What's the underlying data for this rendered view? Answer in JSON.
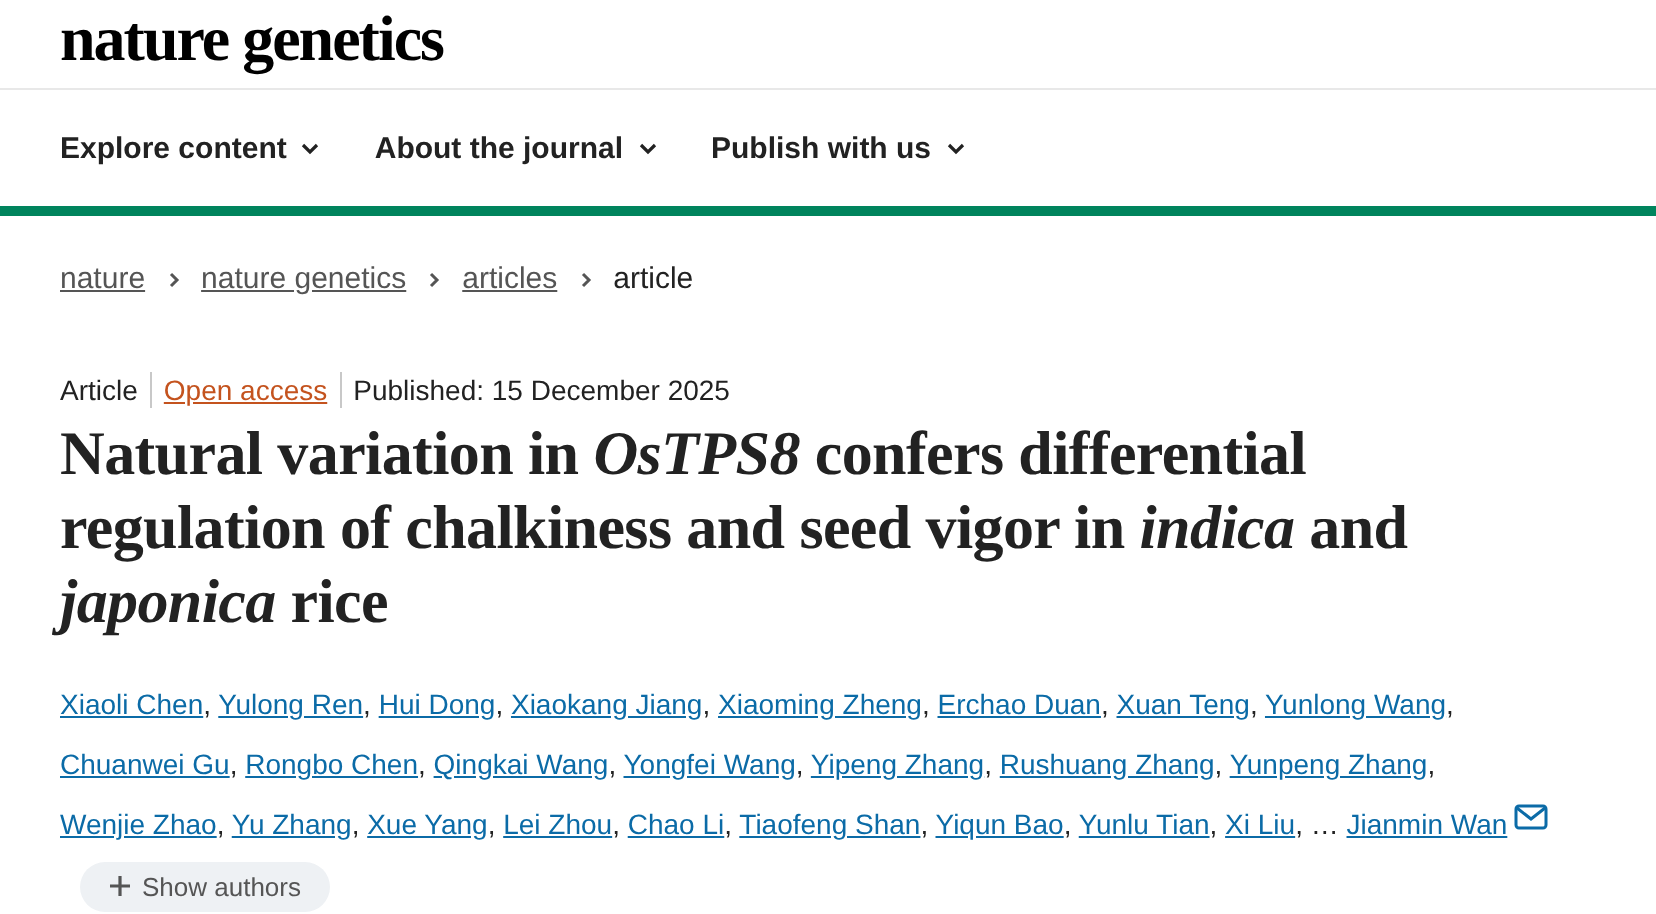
{
  "site": {
    "title": "nature genetics"
  },
  "nav": [
    {
      "label": "Explore content"
    },
    {
      "label": "About the journal"
    },
    {
      "label": "Publish with us"
    }
  ],
  "breadcrumbs": [
    {
      "label": "nature",
      "current": false
    },
    {
      "label": "nature genetics",
      "current": false
    },
    {
      "label": "articles",
      "current": false
    },
    {
      "label": "article",
      "current": true
    }
  ],
  "meta": {
    "type": "Article",
    "access": "Open access",
    "published": "Published: 15 December 2025"
  },
  "title": "Natural variation in *OsTPS8* confers differential regulation of chalkiness and seed vigor in *indica* and *japonica* rice",
  "authors": [
    {
      "name": "Xiaoli Chen",
      "separator": ",",
      "corresponding": false
    },
    {
      "name": "Yulong Ren",
      "separator": ",",
      "corresponding": false
    },
    {
      "name": "Hui Dong",
      "separator": ",",
      "corresponding": false
    },
    {
      "name": "Xiaokang Jiang",
      "separator": ",",
      "corresponding": false
    },
    {
      "name": "Xiaoming Zheng",
      "separator": ",",
      "corresponding": false
    },
    {
      "name": "Erchao Duan",
      "separator": ",",
      "corresponding": false
    },
    {
      "name": "Xuan Teng",
      "separator": ",",
      "corresponding": false
    },
    {
      "name": "Yunlong Wang",
      "separator": ",",
      "corresponding": false
    },
    {
      "name": "Chuanwei Gu",
      "separator": ",",
      "corresponding": false
    },
    {
      "name": "Rongbo Chen",
      "separator": ",",
      "corresponding": false
    },
    {
      "name": "Qingkai Wang",
      "separator": ",",
      "corresponding": false
    },
    {
      "name": "Yongfei Wang",
      "separator": ",",
      "corresponding": false
    },
    {
      "name": "Yipeng Zhang",
      "separator": ",",
      "corresponding": false
    },
    {
      "name": "Rushuang Zhang",
      "separator": ",",
      "corresponding": false
    },
    {
      "name": "Yunpeng Zhang",
      "separator": ",",
      "corresponding": false
    },
    {
      "name": "Wenjie Zhao",
      "separator": ",",
      "corresponding": false
    },
    {
      "name": "Yu Zhang",
      "separator": ",",
      "corresponding": false
    },
    {
      "name": "Xue Yang",
      "separator": ",",
      "corresponding": false
    },
    {
      "name": "Lei Zhou",
      "separator": ",",
      "corresponding": false
    },
    {
      "name": "Chao Li",
      "separator": ",",
      "corresponding": false
    },
    {
      "name": "Tiaofeng Shan",
      "separator": ",",
      "corresponding": false
    },
    {
      "name": "Yiqun Bao",
      "separator": ",",
      "corresponding": false
    },
    {
      "name": "Yunlu Tian",
      "separator": ",",
      "corresponding": false
    },
    {
      "name": "Xi Liu",
      "separator": ", …",
      "corresponding": false
    },
    {
      "name": "Jianmin Wan",
      "corresponding": true
    }
  ],
  "show_authors": {
    "label": "Show authors"
  }
}
